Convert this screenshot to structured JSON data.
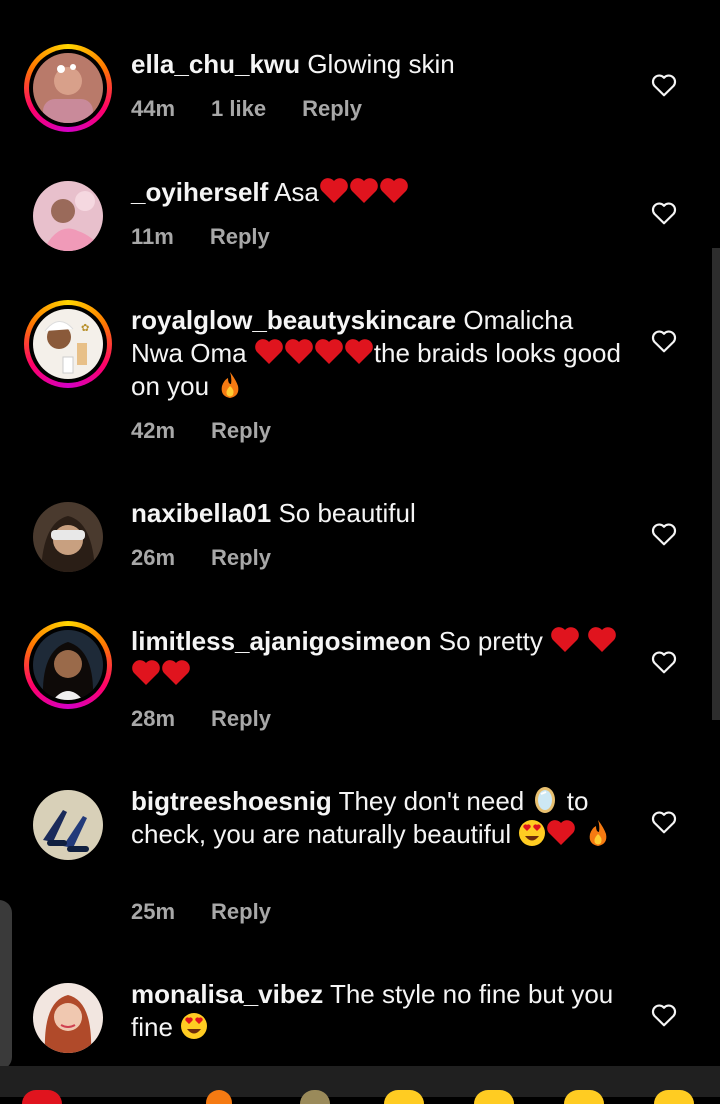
{
  "comments": [
    {
      "username": "ella_chu_kwu",
      "text": "Glowing skin",
      "time": "44m",
      "likes": "1 like",
      "reply": "Reply",
      "story": true
    },
    {
      "username": "_oyiherself",
      "text": "Asa",
      "time": "11m",
      "reply": "Reply",
      "story": false
    },
    {
      "username": "royalglow_beautyskincare",
      "text_a": "Omalicha Nwa Oma",
      "text_b": "the braids looks good on you",
      "time": "42m",
      "reply": "Reply",
      "story": true
    },
    {
      "username": "naxibella01",
      "text": "So beautiful",
      "time": "26m",
      "reply": "Reply",
      "story": false
    },
    {
      "username": "limitless_ajanigosimeon",
      "text": "So pretty",
      "time": "28m",
      "reply": "Reply",
      "story": true
    },
    {
      "username": "bigtreeshoesnig",
      "text_a": "They don't need",
      "text_b": "to check, you are naturally beautiful",
      "time": "25m",
      "reply": "Reply",
      "story": false
    },
    {
      "username": "monalisa_vibez",
      "text": "The style no fine but you fine",
      "story": false
    }
  ],
  "colors": {
    "background": "#000000",
    "text": "#f5f5f5",
    "muted": "#a8a8a8",
    "heart": "#e0141e"
  },
  "icons": {
    "like": "heart-outline-icon",
    "emoji_heart": "red-heart-emoji",
    "fire": "fire-emoji",
    "mirror": "mirror-emoji",
    "heart_eyes": "heart-eyes-emoji"
  }
}
